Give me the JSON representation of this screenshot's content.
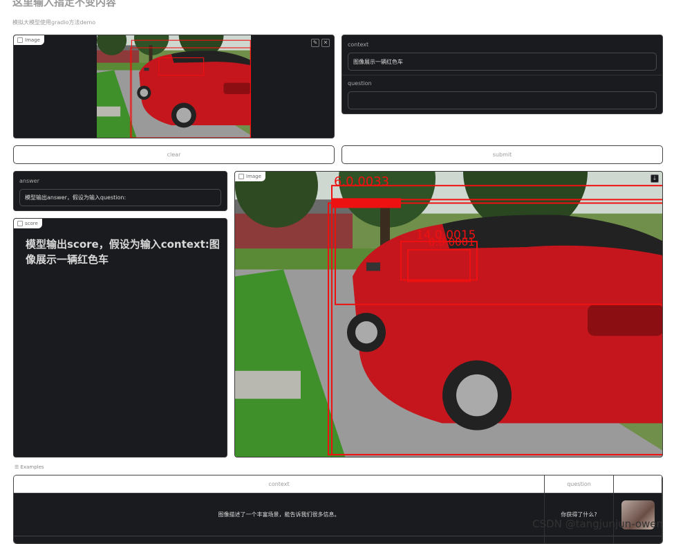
{
  "header": {
    "title": "这里输入指定不变内容",
    "subtitle": "模拟大模型使用gradio方法demo"
  },
  "input_image": {
    "label": "Image"
  },
  "context": {
    "label": "context",
    "value": "图像展示一辆红色车"
  },
  "question": {
    "label": "question",
    "value": ""
  },
  "buttons": {
    "clear": "clear",
    "submit": "submit"
  },
  "answer": {
    "label": "answer",
    "value": "模型输出answer，假设为输入question:"
  },
  "score": {
    "label": "score",
    "value": "模型输出score，假设为输入context:图像展示一辆红色车"
  },
  "output_image": {
    "label": "Image",
    "detections": [
      "6.0.0033",
      "14.0.0015",
      "0.0.0001"
    ]
  },
  "examples": {
    "label": "Examples",
    "headers": [
      "context",
      "question",
      ""
    ],
    "rows": [
      {
        "context": "图像描述了一个丰富场景，能告诉我们很多信息。",
        "question": "你获得了什么?"
      }
    ]
  },
  "watermark": "CSDN @tangjunjun-owen"
}
